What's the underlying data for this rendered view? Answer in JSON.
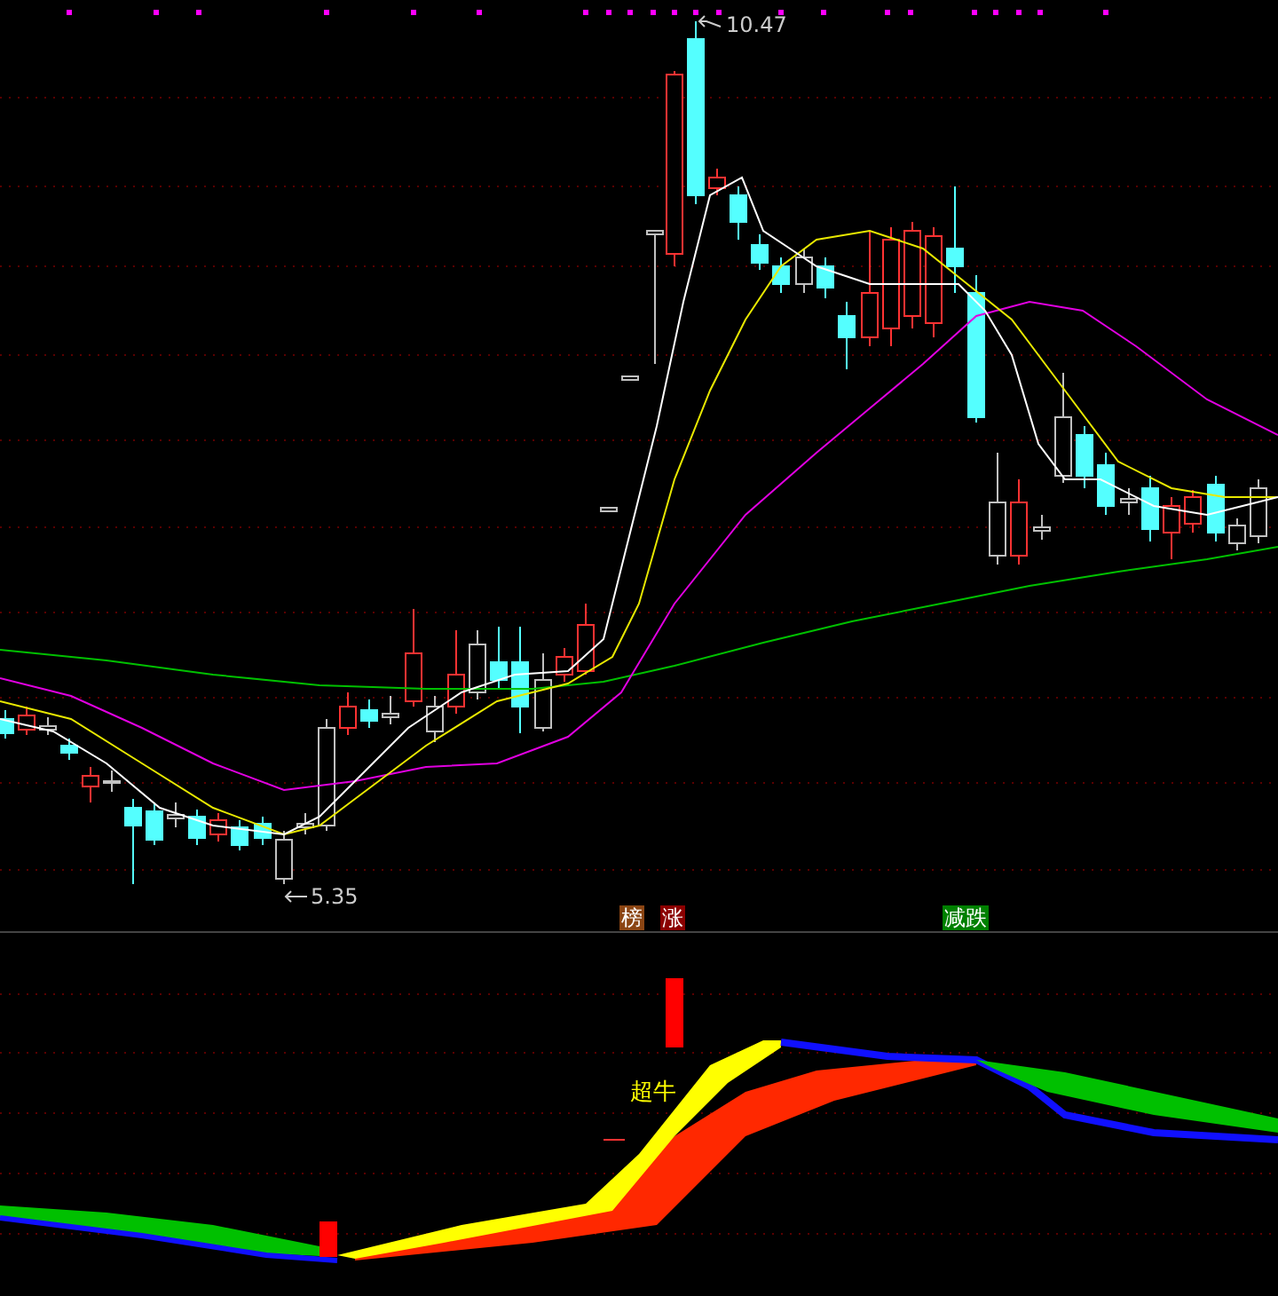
{
  "price_chart": {
    "high_label": "10.47",
    "low_label": "5.35"
  },
  "signals": [
    {
      "label": "榜",
      "color": "#8b4513"
    },
    {
      "label": "涨",
      "color": "#8b0000"
    },
    {
      "label": "减跌",
      "color": "#008000"
    }
  ],
  "indicator": {
    "label": "超牛"
  }
}
